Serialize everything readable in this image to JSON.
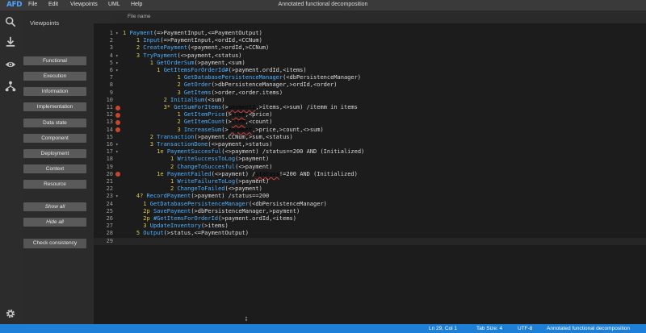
{
  "app": {
    "logo_text": "AFD",
    "window_title": "Annotated functional decomposition",
    "menu": [
      "File",
      "Edit",
      "Viewpoints",
      "UML",
      "Help"
    ]
  },
  "activity_icons": [
    "search-icon",
    "download-icon",
    "eye-icon",
    "hierarchy-icon",
    "gear-icon"
  ],
  "sidebar": {
    "title": "Viewpoints",
    "viewpoints": [
      "Functional",
      "Execution",
      "Information",
      "Implementation",
      "Data state",
      "Component",
      "Deployment",
      "Context",
      "Resource"
    ],
    "show_all": "Show all",
    "hide_all": "Hide all",
    "check_consistency": "Check consistency"
  },
  "editor": {
    "tab_label": "File name",
    "lines": [
      {
        "n": "1",
        "fold": true,
        "err": false,
        "seg": [
          [
            "num",
            "1 "
          ],
          [
            "kw",
            "Payment"
          ],
          [
            "tx",
            "(=>PaymentInput,<=PaymentOutput)"
          ]
        ]
      },
      {
        "n": "2",
        "fold": false,
        "err": false,
        "seg": [
          [
            "tx",
            "    "
          ],
          [
            "num",
            "1 "
          ],
          [
            "kw",
            "Input"
          ],
          [
            "tx",
            "(=>PaymentInput,<ordId,<CCNum)"
          ]
        ]
      },
      {
        "n": "3",
        "fold": false,
        "err": false,
        "seg": [
          [
            "tx",
            "    "
          ],
          [
            "num",
            "2 "
          ],
          [
            "kw",
            "CreatePayment"
          ],
          [
            "tx",
            "(<payment,>ordId,>CCNum)"
          ]
        ]
      },
      {
        "n": "4",
        "fold": true,
        "err": false,
        "seg": [
          [
            "tx",
            "    "
          ],
          [
            "num",
            "3 "
          ],
          [
            "kw",
            "TryPayment"
          ],
          [
            "tx",
            "(<>payment,<status)"
          ]
        ]
      },
      {
        "n": "5",
        "fold": true,
        "err": false,
        "seg": [
          [
            "tx",
            "        "
          ],
          [
            "num",
            "1 "
          ],
          [
            "kw",
            "GetOrderSum"
          ],
          [
            "tx",
            "(>payment,<sum)"
          ]
        ]
      },
      {
        "n": "6",
        "fold": true,
        "err": false,
        "seg": [
          [
            "tx",
            "          "
          ],
          [
            "num",
            "1 "
          ],
          [
            "kw",
            "GetItemsForOrderId#"
          ],
          [
            "tx",
            "(>payment.ordId,<items)"
          ]
        ]
      },
      {
        "n": "7",
        "fold": false,
        "err": false,
        "seg": [
          [
            "tx",
            "                "
          ],
          [
            "num",
            "1 "
          ],
          [
            "kw",
            "GetDatabasePersistenceManager"
          ],
          [
            "tx",
            "(<dbPersistenceManager)"
          ]
        ]
      },
      {
        "n": "8",
        "fold": false,
        "err": false,
        "seg": [
          [
            "tx",
            "                "
          ],
          [
            "num",
            "2 "
          ],
          [
            "kw",
            "GetOrder"
          ],
          [
            "tx",
            "(>dbPersistenceManager,>ordId,<order)"
          ]
        ]
      },
      {
        "n": "9",
        "fold": false,
        "err": false,
        "seg": [
          [
            "tx",
            "                "
          ],
          [
            "num",
            "3 "
          ],
          [
            "kw",
            "GetItems"
          ],
          [
            "tx",
            "(>order,<order.items)"
          ]
        ]
      },
      {
        "n": "10",
        "fold": false,
        "err": false,
        "seg": [
          [
            "tx",
            "            "
          ],
          [
            "num",
            "2 "
          ],
          [
            "kw",
            "InitialSum"
          ],
          [
            "tx",
            "(<sum)"
          ]
        ]
      },
      {
        "n": "11",
        "fold": true,
        "err": true,
        "seg": [
          [
            "tx",
            "            "
          ],
          [
            "num",
            "3* "
          ],
          [
            "kw",
            "GetSumForItems"
          ],
          [
            "tx",
            "(>"
          ],
          [
            "bad",
            "payment2"
          ],
          [
            "tx",
            ",>items,<>sum) /itemm in items"
          ]
        ]
      },
      {
        "n": "12",
        "fold": false,
        "err": true,
        "seg": [
          [
            "tx",
            "                "
          ],
          [
            "num",
            "1 "
          ],
          [
            "kw",
            "GetItemPrice"
          ],
          [
            "tx",
            "(>"
          ],
          [
            "bad",
            "item"
          ],
          [
            "tx",
            ",<price)"
          ]
        ]
      },
      {
        "n": "13",
        "fold": false,
        "err": true,
        "seg": [
          [
            "tx",
            "                "
          ],
          [
            "num",
            "2 "
          ],
          [
            "kw",
            "GetItemCount"
          ],
          [
            "tx",
            "(>"
          ],
          [
            "bad",
            "item"
          ],
          [
            "tx",
            ",<count)"
          ]
        ]
      },
      {
        "n": "14",
        "fold": false,
        "err": true,
        "seg": [
          [
            "tx",
            "                "
          ],
          [
            "num",
            "3 "
          ],
          [
            "kw",
            "IncreaseSum"
          ],
          [
            "tx",
            "(>"
          ],
          [
            "bad",
            "payment"
          ],
          [
            "tx",
            ",>price,>count,<>sum)"
          ]
        ]
      },
      {
        "n": "15",
        "fold": false,
        "err": false,
        "seg": [
          [
            "tx",
            "        "
          ],
          [
            "num",
            "2 "
          ],
          [
            "kw",
            "Transaction"
          ],
          [
            "tx",
            "(>payment.CCNum,>sum,<status)"
          ]
        ]
      },
      {
        "n": "16",
        "fold": true,
        "err": false,
        "seg": [
          [
            "tx",
            "        "
          ],
          [
            "num",
            "3 "
          ],
          [
            "kw",
            "TransactionDone"
          ],
          [
            "tx",
            "(<>payment,>status)"
          ]
        ]
      },
      {
        "n": "17",
        "fold": true,
        "err": false,
        "seg": [
          [
            "tx",
            "          "
          ],
          [
            "num",
            "1e "
          ],
          [
            "kw",
            "PaymentSuccesful"
          ],
          [
            "tx",
            "(<>payment) /status==200 AND (Initialized)"
          ]
        ]
      },
      {
        "n": "18",
        "fold": false,
        "err": false,
        "seg": [
          [
            "tx",
            "              "
          ],
          [
            "num",
            "1 "
          ],
          [
            "kw",
            "WriteSuccessToLog"
          ],
          [
            "tx",
            "(>payment)"
          ]
        ]
      },
      {
        "n": "19",
        "fold": false,
        "err": false,
        "seg": [
          [
            "tx",
            "              "
          ],
          [
            "num",
            "2 "
          ],
          [
            "kw",
            "ChangeToSuccesful"
          ],
          [
            "tx",
            "(<>payment)"
          ]
        ]
      },
      {
        "n": "20",
        "fold": true,
        "err": true,
        "seg": [
          [
            "tx",
            "          "
          ],
          [
            "num",
            "1e "
          ],
          [
            "kw",
            "PaymentFailed"
          ],
          [
            "tx",
            "(<>payment) /"
          ],
          [
            "bad",
            "statuss"
          ],
          [
            "tx",
            "!=200 AND (Initialized)"
          ]
        ]
      },
      {
        "n": "21",
        "fold": false,
        "err": false,
        "seg": [
          [
            "tx",
            "              "
          ],
          [
            "num",
            "1 "
          ],
          [
            "kw",
            "WriteFailureToLog"
          ],
          [
            "tx",
            "(>payment)"
          ]
        ]
      },
      {
        "n": "22",
        "fold": false,
        "err": false,
        "seg": [
          [
            "tx",
            "              "
          ],
          [
            "num",
            "2 "
          ],
          [
            "kw",
            "ChangeToFailed"
          ],
          [
            "tx",
            "(<>payment)"
          ]
        ]
      },
      {
        "n": "23",
        "fold": true,
        "err": false,
        "seg": [
          [
            "tx",
            "    "
          ],
          [
            "num",
            "4? "
          ],
          [
            "kw",
            "RecordPayment"
          ],
          [
            "tx",
            "(>payment) /status==200"
          ]
        ]
      },
      {
        "n": "24",
        "fold": false,
        "err": false,
        "seg": [
          [
            "tx",
            "      "
          ],
          [
            "num",
            "1 "
          ],
          [
            "kw",
            "GetDatabasePersistenceManager"
          ],
          [
            "tx",
            "(<dbPersistenceManager)"
          ]
        ]
      },
      {
        "n": "25",
        "fold": false,
        "err": false,
        "seg": [
          [
            "tx",
            "      "
          ],
          [
            "num",
            "2p "
          ],
          [
            "kw",
            "SavePayment"
          ],
          [
            "tx",
            "(>dbPersistenceManager,>payment)"
          ]
        ]
      },
      {
        "n": "26",
        "fold": false,
        "err": false,
        "seg": [
          [
            "tx",
            "      "
          ],
          [
            "num",
            "2p "
          ],
          [
            "kw",
            "#GetItemsForOrderId"
          ],
          [
            "tx",
            "(>payment.ordId,<items)"
          ]
        ]
      },
      {
        "n": "27",
        "fold": false,
        "err": false,
        "seg": [
          [
            "tx",
            "      "
          ],
          [
            "num",
            "3 "
          ],
          [
            "kw",
            "UpdateInventory"
          ],
          [
            "tx",
            "(>items)"
          ]
        ]
      },
      {
        "n": "28",
        "fold": false,
        "err": false,
        "seg": [
          [
            "tx",
            "    "
          ],
          [
            "num",
            "5 "
          ],
          [
            "kw",
            "Output"
          ],
          [
            "tx",
            "(>status,<=PaymentOutput)"
          ]
        ]
      },
      {
        "n": "29",
        "fold": false,
        "err": false,
        "seg": []
      }
    ]
  },
  "statusbar": {
    "position": "Ln 29, Col 1",
    "tab_size": "Tab Size: 4",
    "encoding": "UTF-8",
    "language": "Annotated functional decomposition"
  },
  "colors": {
    "accent": "#1e7fd6",
    "keyword": "#4fb0ff",
    "number": "#d7c950",
    "error": "#c9462c"
  }
}
